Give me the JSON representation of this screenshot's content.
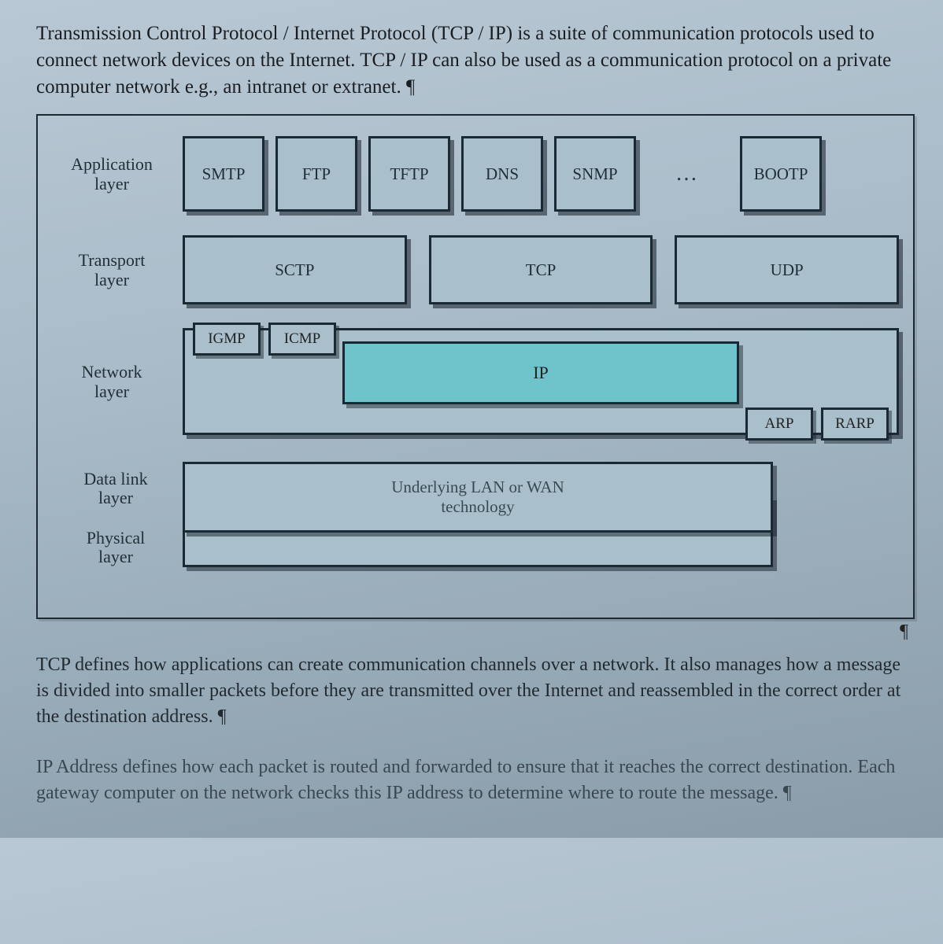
{
  "intro_paragraph": "Transmission Control Protocol / Internet Protocol (TCP / IP) is a suite of communication protocols used to connect network devices on the Internet. TCP / IP can also be used as a communication protocol on a private computer network e.g., an intranet or extranet. ¶",
  "layers": {
    "application": {
      "label1": "Application",
      "label2": "layer",
      "boxes": [
        "SMTP",
        "FTP",
        "TFTP",
        "DNS",
        "SNMP",
        "…",
        "BOOTP"
      ]
    },
    "transport": {
      "label1": "Transport",
      "label2": "layer",
      "boxes": [
        "SCTP",
        "TCP",
        "UDP"
      ]
    },
    "network": {
      "label1": "Network",
      "label2": "layer",
      "ip": "IP",
      "igmp": "IGMP",
      "icmp": "ICMP",
      "arp": "ARP",
      "rarp": "RARP"
    },
    "datalink": {
      "label1": "Data link",
      "label2": "layer"
    },
    "physical": {
      "label1": "Physical",
      "label2": "layer"
    },
    "underlying_line1": "Underlying LAN or WAN",
    "underlying_line2": "technology"
  },
  "tcp_paragraph": "TCP defines how applications can create communication channels over a network. It also manages how a message is divided into smaller packets before they are transmitted over the Internet and reassembled in the correct order at the destination address. ¶",
  "ip_paragraph": "IP Address defines how each packet is routed and forwarded to ensure that it reaches the correct destination. Each gateway computer on the network checks this IP address to determine where to route the message. ¶",
  "pilcrow": "¶"
}
